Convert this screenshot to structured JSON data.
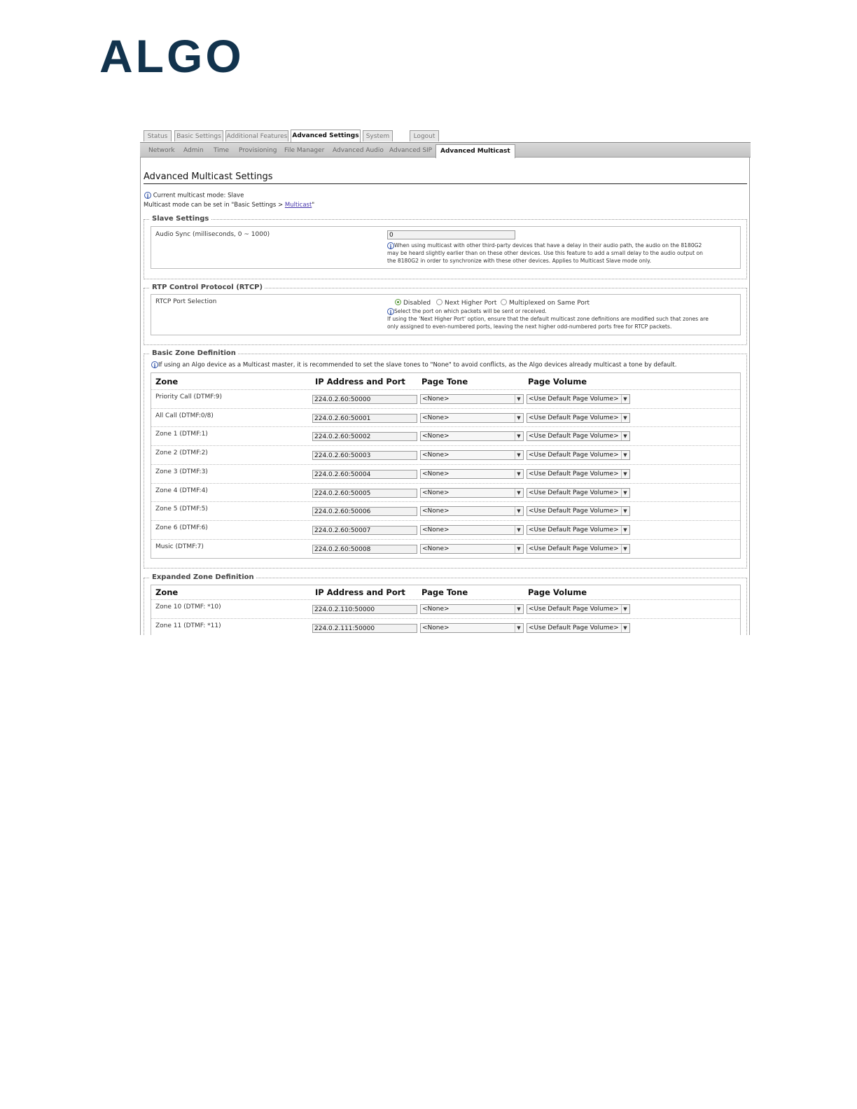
{
  "brand": {
    "logo": "ALGO"
  },
  "top_tabs": [
    {
      "label": "Status"
    },
    {
      "label": "Basic Settings"
    },
    {
      "label": "Additional Features"
    },
    {
      "label": "Advanced Settings"
    },
    {
      "label": "System"
    },
    {
      "label": "Logout"
    }
  ],
  "sub_tabs": [
    {
      "label": "Network"
    },
    {
      "label": "Admin"
    },
    {
      "label": "Time"
    },
    {
      "label": "Provisioning"
    },
    {
      "label": "File Manager"
    },
    {
      "label": "Advanced Audio"
    },
    {
      "label": "Advanced SIP"
    },
    {
      "label": "Advanced Multicast"
    }
  ],
  "page": {
    "title": "Advanced Multicast Settings",
    "current_mode": "Current multicast mode: Slave",
    "mode_hint_prefix": "Multicast mode can be set in \"Basic Settings > ",
    "mode_hint_link": "Multicast",
    "mode_hint_suffix": "\""
  },
  "slave": {
    "legend": "Slave Settings",
    "label": "Audio Sync (milliseconds, 0 ~ 1000)",
    "value": "0",
    "help1": "When using multicast with other third-party devices that have a delay in their audio path, the audio on the 8180G2",
    "help2": "may be heard slightly earlier than on these other devices. Use this feature to add a small delay to the audio output on",
    "help3": "the 8180G2 in order to synchronize with these other devices. Applies to Multicast Slave mode only."
  },
  "rtcp": {
    "legend": "RTP Control Protocol (RTCP)",
    "label": "RTCP Port Selection",
    "options": [
      "Disabled",
      "Next Higher Port",
      "Multiplexed on Same Port"
    ],
    "selected": "Disabled",
    "help1": "Select the port on which packets will be sent or received.",
    "help2": "If using the 'Next Higher Port' option, ensure that the default multicast zone definitions are modified such that zones are",
    "help3": "only assigned to even-numbered ports, leaving the next higher odd-numbered ports free for RTCP packets."
  },
  "basic_zone": {
    "legend": "Basic Zone Definition",
    "note": "If using an Algo device as a Multicast master, it is recommended to set the slave tones to \"None\" to avoid conflicts, as the Algo devices already multicast a tone by default.",
    "headers": [
      "Zone",
      "IP Address and Port",
      "Page Tone",
      "Page Volume"
    ],
    "rows": [
      {
        "zone": "Priority Call (DTMF:9)",
        "ip": "224.0.2.60:50000",
        "tone": "<None>",
        "volume": "<Use Default Page Volume>"
      },
      {
        "zone": "All Call (DTMF:0/8)",
        "ip": "224.0.2.60:50001",
        "tone": "<None>",
        "volume": "<Use Default Page Volume>"
      },
      {
        "zone": "Zone 1 (DTMF:1)",
        "ip": "224.0.2.60:50002",
        "tone": "<None>",
        "volume": "<Use Default Page Volume>"
      },
      {
        "zone": "Zone 2 (DTMF:2)",
        "ip": "224.0.2.60:50003",
        "tone": "<None>",
        "volume": "<Use Default Page Volume>"
      },
      {
        "zone": "Zone 3 (DTMF:3)",
        "ip": "224.0.2.60:50004",
        "tone": "<None>",
        "volume": "<Use Default Page Volume>"
      },
      {
        "zone": "Zone 4 (DTMF:4)",
        "ip": "224.0.2.60:50005",
        "tone": "<None>",
        "volume": "<Use Default Page Volume>"
      },
      {
        "zone": "Zone 5 (DTMF:5)",
        "ip": "224.0.2.60:50006",
        "tone": "<None>",
        "volume": "<Use Default Page Volume>"
      },
      {
        "zone": "Zone 6 (DTMF:6)",
        "ip": "224.0.2.60:50007",
        "tone": "<None>",
        "volume": "<Use Default Page Volume>"
      },
      {
        "zone": "Music (DTMF:7)",
        "ip": "224.0.2.60:50008",
        "tone": "<None>",
        "volume": "<Use Default Page Volume>"
      }
    ]
  },
  "expanded_zone": {
    "legend": "Expanded Zone Definition",
    "headers": [
      "Zone",
      "IP Address and Port",
      "Page Tone",
      "Page Volume"
    ],
    "rows": [
      {
        "zone": "Zone 10 (DTMF: *10)",
        "ip": "224.0.2.110:50000",
        "tone": "<None>",
        "volume": "<Use Default Page Volume>"
      },
      {
        "zone": "Zone 11 (DTMF: *11)",
        "ip": "224.0.2.111:50000",
        "tone": "<None>",
        "volume": "<Use Default Page Volume>"
      }
    ]
  }
}
